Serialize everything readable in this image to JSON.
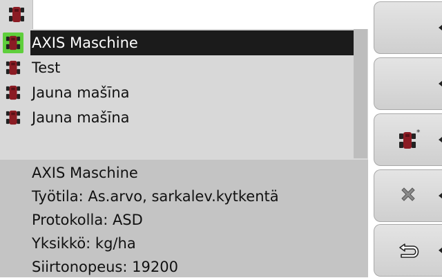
{
  "tab": {
    "icon": "machine-icon"
  },
  "list": {
    "items": [
      {
        "label": "AXIS Maschine",
        "selected": true,
        "icon": "machine-icon"
      },
      {
        "label": "Test",
        "selected": false,
        "icon": "machine-icon"
      },
      {
        "label": "Jauna mašīna",
        "selected": false,
        "icon": "machine-icon"
      },
      {
        "label": "Jauna mašīna",
        "selected": false,
        "icon": "machine-icon"
      }
    ]
  },
  "info": {
    "name": "AXIS Maschine",
    "mode": "Työtila: As.arvo, sarkalev.kytkentä",
    "protocol": "Protokolla: ASD",
    "unit": "Yksikkö: kg/ha",
    "baud": "Siirtonopeus: 19200"
  },
  "softkeys": [
    {
      "icon": "",
      "name": "empty"
    },
    {
      "icon": "",
      "name": "empty"
    },
    {
      "icon": "new-machine-icon",
      "name": "new-machine"
    },
    {
      "icon": "delete-icon",
      "name": "delete"
    },
    {
      "icon": "back-icon",
      "name": "back"
    }
  ],
  "colors": {
    "accent": "#8b1c24",
    "selected_bg": "#1b1b1b",
    "selected_icon_bg": "#5fcf3c",
    "panel": "#d8d8d8",
    "info_panel": "#c4c4c4"
  }
}
